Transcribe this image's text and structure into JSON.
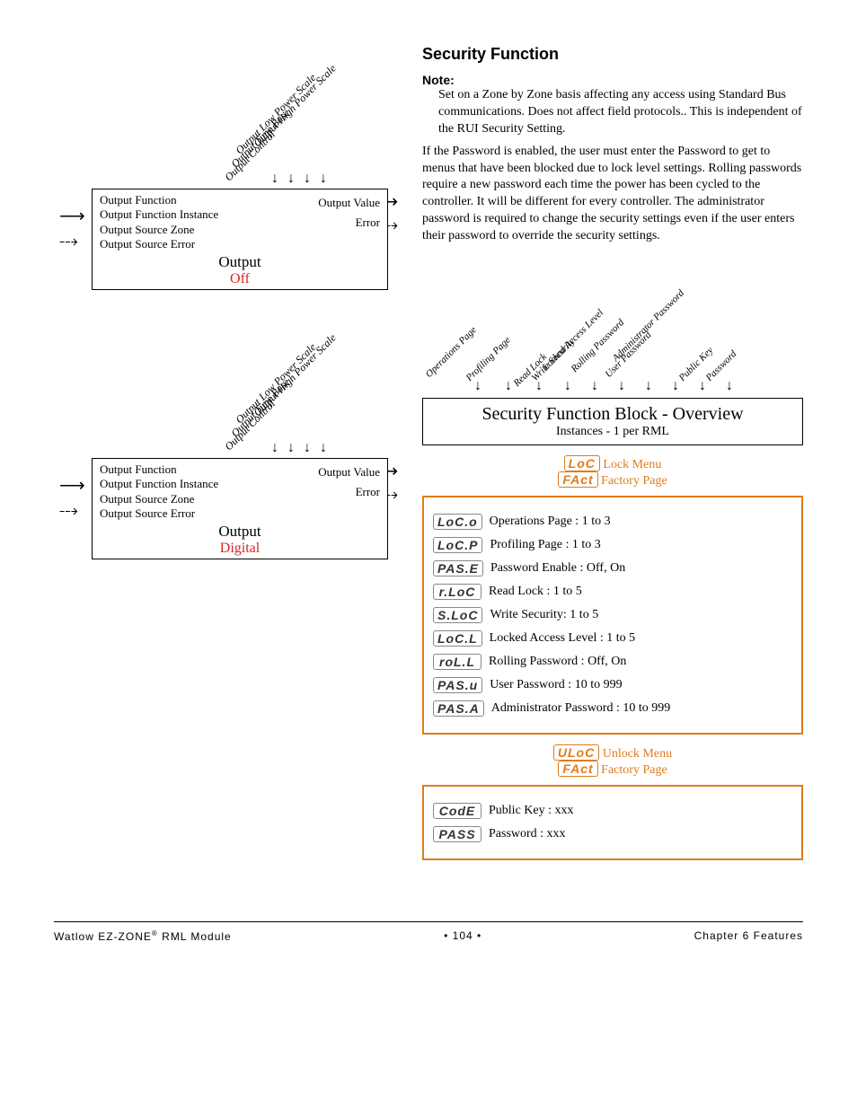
{
  "left": {
    "block1": {
      "top_labels": [
        "Output High Power Scale",
        "Output Low Power Scale",
        "Output Time Base",
        "Output Control"
      ],
      "left_list": [
        "Output Function",
        "Output Function Instance",
        "Output Source Zone",
        "Output Source Error"
      ],
      "right_list": [
        "Output Value",
        "Error"
      ],
      "title": "Output",
      "sub": "Off"
    },
    "block2": {
      "top_labels": [
        "Output High Power Scale",
        "Output Low Power Scale",
        "Output Time Base",
        "Output Control"
      ],
      "left_list": [
        "Output Function",
        "Output Function Instance",
        "Output Source Zone",
        "Output Source Error"
      ],
      "right_list": [
        "Output Value",
        "Error"
      ],
      "title": "Output",
      "sub": "Digital"
    }
  },
  "right": {
    "heading": "Security Function",
    "note_label": "Note:",
    "note_body": "Set on a Zone by Zone basis affecting any access using Standard Bus communications. Does not affect field protocols.. This is independent of the RUI Security Setting.",
    "para": "If the Password is enabled, the user must enter the Password to get to menus that have been blocked due to lock level settings. Rolling passwords require a new password each time the power has been cycled to the controller. It will be different for every controller. The administrator password is required to change the security settings even if the user enters their password to override the security settings.",
    "sec_top_labels": [
      "Operations Page",
      "Profiling Page",
      "Read Lock",
      "Write Security",
      "Locked Access Level",
      "Rolling Password",
      "User Password",
      "Administrator Password",
      "Public Key",
      "Password"
    ],
    "sec_box_title": "Security Function Block - Overview",
    "sec_box_sub": "Instances - 1 per RML",
    "lock_menu": {
      "seg1": "LoC",
      "label1": "Lock Menu",
      "seg2": "FAct",
      "label2": "Factory Page"
    },
    "params1": [
      {
        "seg": "LoC.o",
        "label": "Operations Page : 1 to 3"
      },
      {
        "seg": "LoC.P",
        "label": "Profiling Page : 1 to 3"
      },
      {
        "seg": "PAS.E",
        "label": "Password Enable : Off, On"
      },
      {
        "seg": "r.LoC",
        "label": "Read Lock : 1 to 5"
      },
      {
        "seg": "S.LoC",
        "label": "Write Security: 1 to 5"
      },
      {
        "seg": "LoC.L",
        "label": "Locked Access Level : 1 to 5"
      },
      {
        "seg": "roL.L",
        "label": "Rolling Password : Off, On"
      },
      {
        "seg": "PAS.u",
        "label": "User Password : 10 to 999"
      },
      {
        "seg": "PAS.A",
        "label": "Administrator Password : 10 to 999"
      }
    ],
    "unlock_menu": {
      "seg1": "ULoC",
      "label1": "Unlock Menu",
      "seg2": "FAct",
      "label2": "Factory Page"
    },
    "params2": [
      {
        "seg": "CodE",
        "label": "Public Key : xxx"
      },
      {
        "seg": "PASS",
        "label": "Password : xxx"
      }
    ]
  },
  "footer": {
    "left": "Watlow EZ-ZONE",
    "left_sup": "®",
    "left_tail": " RML Module",
    "mid_pre": "•  ",
    "mid": "104",
    "mid_post": "  •",
    "right": "Chapter 6 Features"
  }
}
